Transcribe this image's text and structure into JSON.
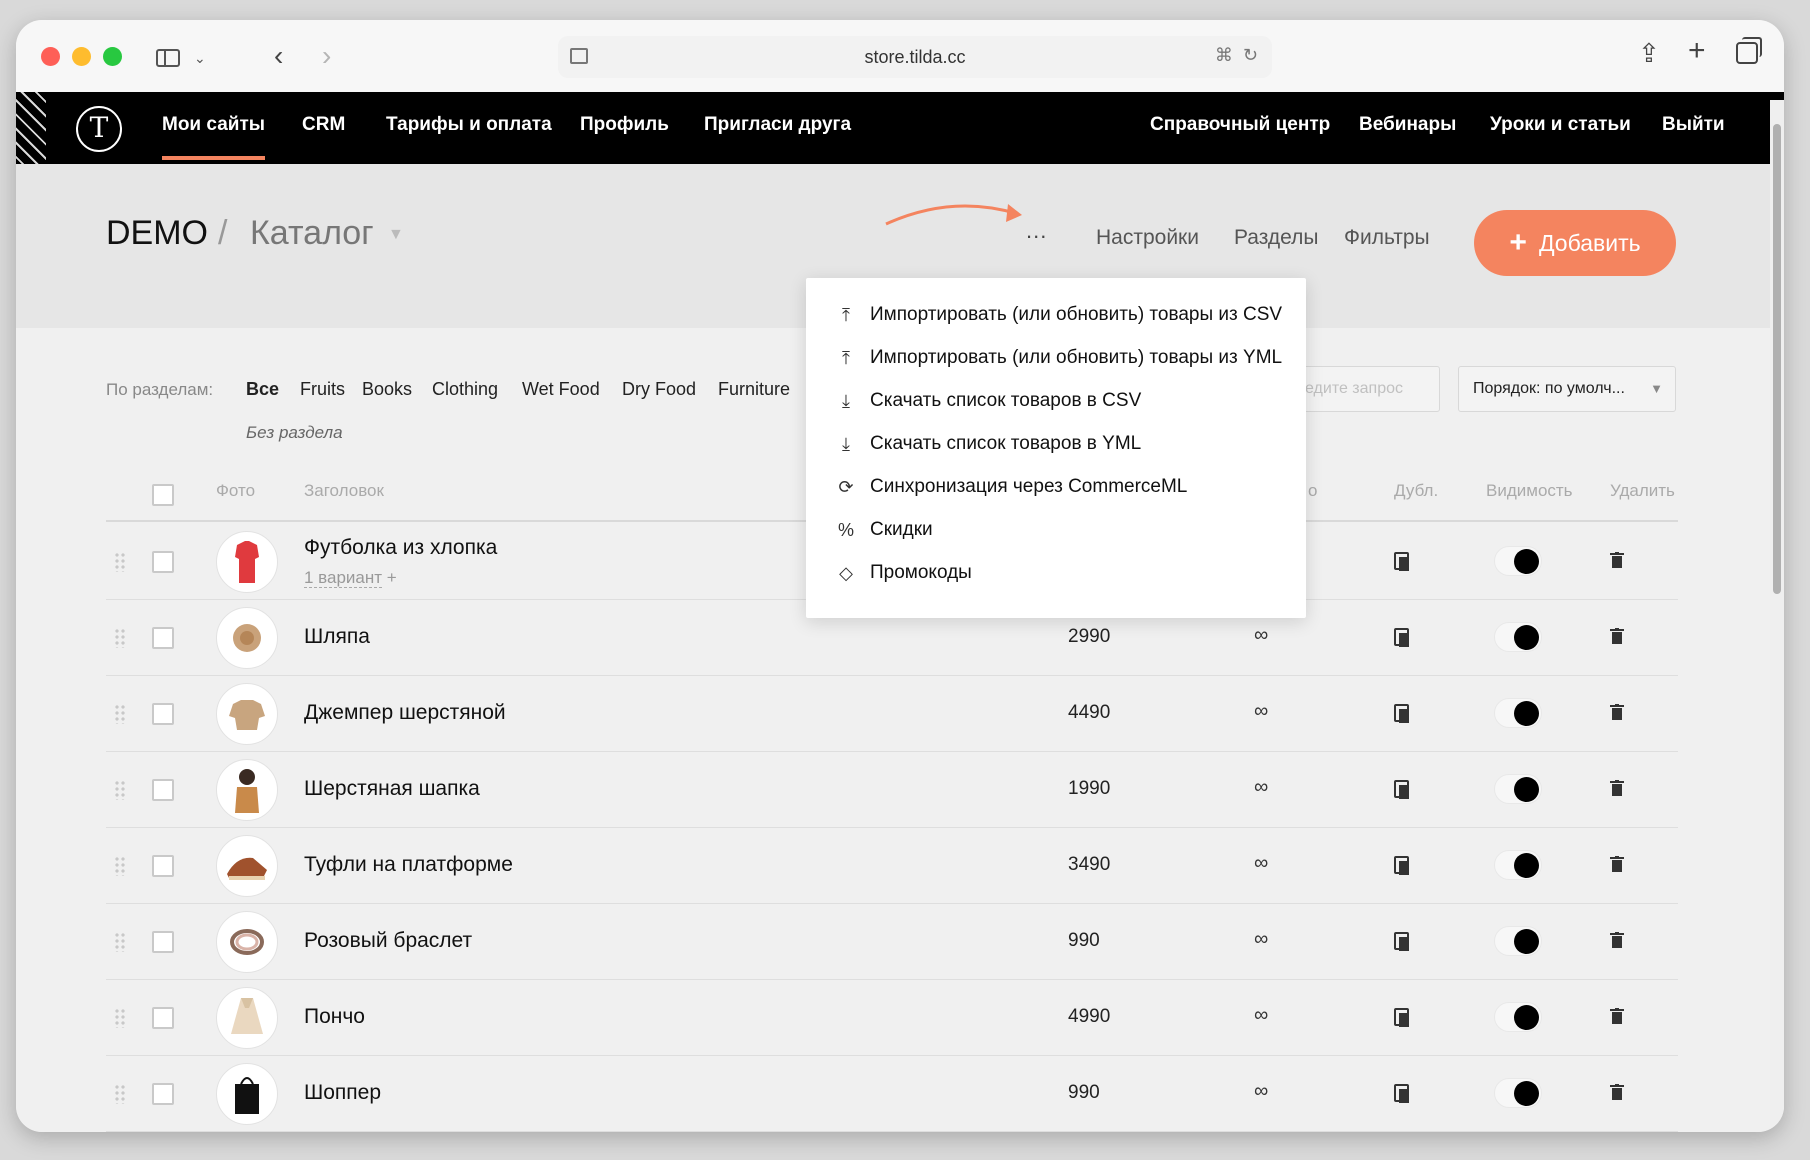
{
  "browser": {
    "url": "store.tilda.cc"
  },
  "topnav": {
    "logo": "T",
    "left": [
      "Мои сайты",
      "CRM",
      "Тарифы и оплата",
      "Профиль",
      "Пригласи друга"
    ],
    "right": [
      "Справочный центр",
      "Вебинары",
      "Уроки и статьи",
      "Выйти"
    ]
  },
  "header": {
    "project": "DEMO",
    "separator": "/",
    "section": "Каталог",
    "more": "...",
    "links": [
      "Настройки",
      "Разделы",
      "Фильтры"
    ],
    "add_label": "Добавить",
    "add_plus": "+"
  },
  "filters": {
    "label": "По разделам:",
    "items": [
      "Все",
      "Fruits",
      "Books",
      "Clothing",
      "Wet Food",
      "Dry Food",
      "Furniture"
    ],
    "none": "Без раздела"
  },
  "search": {
    "placeholder": "ведите запрос"
  },
  "sort": {
    "value": "Порядок: по умолч...",
    "caret": "▼"
  },
  "table": {
    "headers": {
      "photo": "Фото",
      "title": "Заголовок",
      "qty": "о",
      "dup": "Дубл.",
      "visibility": "Видимость",
      "delete": "Удалить"
    },
    "rows": [
      {
        "title": "Футболка из хлопка",
        "variant": "1 вариант",
        "variant_plus": "+",
        "price": "",
        "qty": ""
      },
      {
        "title": "Шляпа",
        "price": "2990",
        "qty": "∞"
      },
      {
        "title": "Джемпер шерстяной",
        "price": "4490",
        "qty": "∞"
      },
      {
        "title": "Шерстяная шапка",
        "price": "1990",
        "qty": "∞"
      },
      {
        "title": "Туфли на платформе",
        "price": "3490",
        "qty": "∞"
      },
      {
        "title": "Розовый браслет",
        "price": "990",
        "qty": "∞"
      },
      {
        "title": "Пончо",
        "price": "4990",
        "qty": "∞"
      },
      {
        "title": "Шоппер",
        "price": "990",
        "qty": "∞"
      }
    ]
  },
  "dropdown": {
    "items": [
      {
        "icon": "⤒",
        "label": "Импортировать (или обновить) товары из CSV"
      },
      {
        "icon": "⤒",
        "label": "Импортировать (или обновить) товары из YML"
      },
      {
        "icon": "⤓",
        "label": "Скачать список товаров в CSV"
      },
      {
        "icon": "⤓",
        "label": "Скачать список товаров в YML"
      },
      {
        "icon": "⟳",
        "label": "Синхронизация через CommerceML"
      },
      {
        "icon": "%",
        "label": "Скидки"
      },
      {
        "icon": "◇",
        "label": "Промокоды"
      }
    ]
  },
  "colors": {
    "accent": "#f4845f",
    "nav_bg": "#000000"
  }
}
